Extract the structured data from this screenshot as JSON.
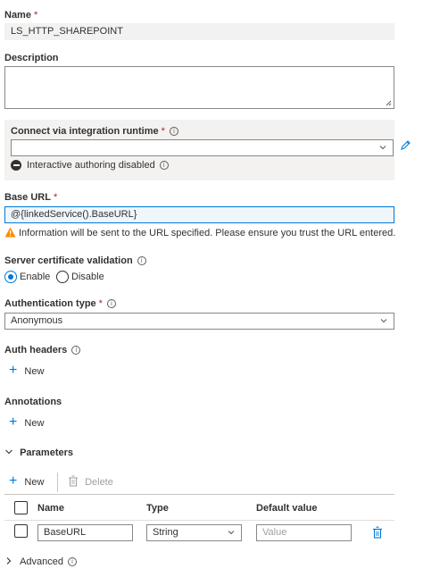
{
  "name": {
    "label": "Name",
    "required": "*",
    "value": "LS_HTTP_SHAREPOINT"
  },
  "description": {
    "label": "Description",
    "value": ""
  },
  "runtime": {
    "label": "Connect via integration runtime",
    "required": "*",
    "info": "i",
    "value": "",
    "status_text": "Interactive authoring disabled",
    "status_info": "i"
  },
  "base_url": {
    "label": "Base URL",
    "required": "*",
    "value": "@{linkedService().BaseURL}",
    "warning": "Information will be sent to the URL specified. Please ensure you trust the URL entered."
  },
  "server_cert": {
    "label": "Server certificate validation",
    "info": "i",
    "options": [
      "Enable",
      "Disable"
    ],
    "selected": "Enable"
  },
  "auth_type": {
    "label": "Authentication type",
    "required": "*",
    "info": "i",
    "value": "Anonymous"
  },
  "auth_headers": {
    "label": "Auth headers",
    "info": "i",
    "new_label": "New"
  },
  "annotations": {
    "label": "Annotations",
    "new_label": "New"
  },
  "parameters": {
    "label": "Parameters",
    "new_label": "New",
    "delete_label": "Delete",
    "columns": [
      "Name",
      "Type",
      "Default value"
    ],
    "rows": [
      {
        "name": "BaseURL",
        "type": "String",
        "default_placeholder": "Value"
      }
    ]
  },
  "advanced": {
    "label": "Advanced",
    "info": "i"
  },
  "colors": {
    "accent": "#0078d4",
    "required": "#a4262c",
    "warning": "#ff8c00",
    "disabled_bg": "#f3f2f1",
    "section_bg": "#f3f2f1"
  }
}
